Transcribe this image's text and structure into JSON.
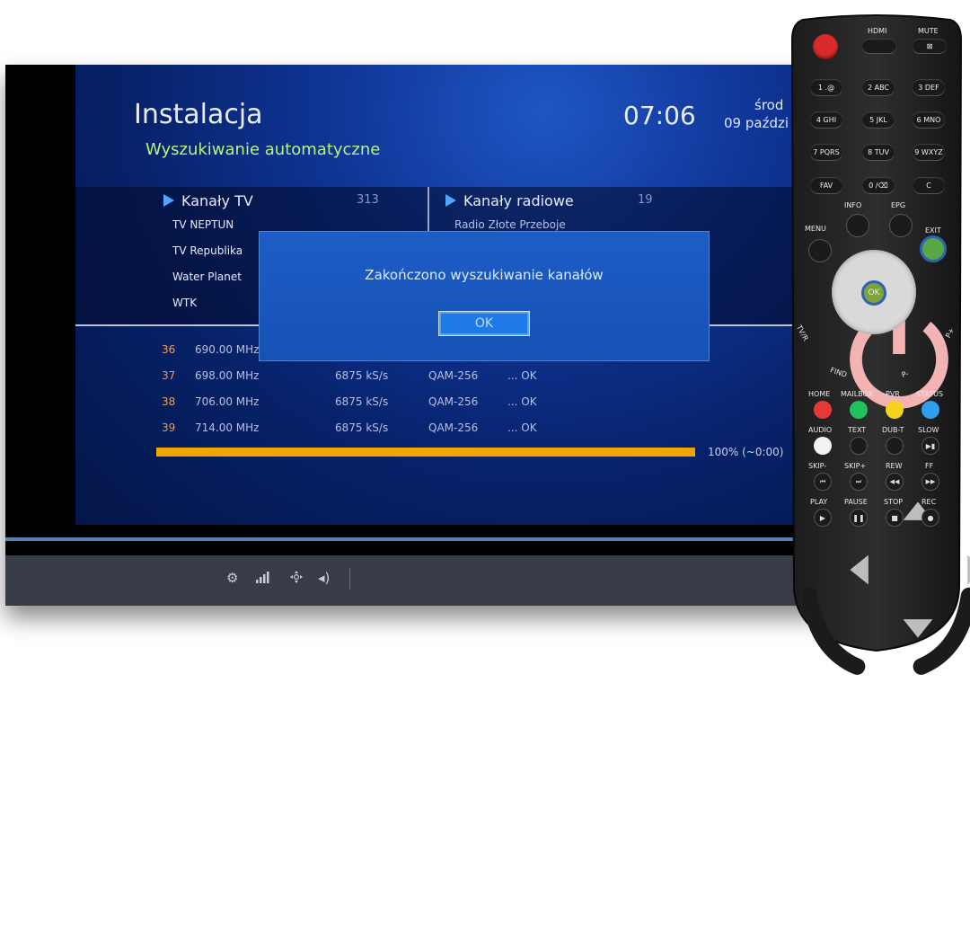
{
  "screen": {
    "title": "Instalacja",
    "subtitle": "Wyszukiwanie automatyczne",
    "clock": "07:06",
    "date_line1": "środ",
    "date_line2": "09 paździ",
    "tv_header": "Kanały TV",
    "tv_count": "313",
    "radio_header": "Kanały radiowe",
    "radio_count": "19",
    "tv_channels": [
      "TV NEPTUN",
      "TV Republika",
      "Water Planet",
      "WTK"
    ],
    "radio_channels": [
      "Radio Złote Przeboje"
    ],
    "scan_rows": [
      {
        "num": "36",
        "freq": "690.00 MHz",
        "rate": "",
        "mod": "",
        "status": ""
      },
      {
        "num": "37",
        "freq": "698.00 MHz",
        "rate": "6875 kS/s",
        "mod": "QAM-256",
        "status": "... OK"
      },
      {
        "num": "38",
        "freq": "706.00 MHz",
        "rate": "6875 kS/s",
        "mod": "QAM-256",
        "status": "... OK"
      },
      {
        "num": "39",
        "freq": "714.00 MHz",
        "rate": "6875 kS/s",
        "mod": "QAM-256",
        "status": "... OK"
      }
    ],
    "progress_fraction": 1.0,
    "progress_text": "100% (~0:00)",
    "dialog_message": "Zakończono wyszukiwanie kanałów",
    "dialog_ok": "OK"
  },
  "bottom_bar_icons": [
    "settings-icon",
    "signal-icon",
    "navigate-icon",
    "volume-icon"
  ],
  "remote": {
    "hdmi": "HDMI",
    "mute": "MUTE",
    "num_keys": [
      "1 .@",
      "2 ABC",
      "3 DEF",
      "4 GHI",
      "5 JKL",
      "6 MNO",
      "7 PQRS",
      "8 TUV",
      "9 WXYZ",
      "FAV",
      "0 /⌫",
      "C"
    ],
    "info": "INFO",
    "epg": "EPG",
    "menu": "MENU",
    "exit": "EXIT",
    "ok": "OK",
    "tv_radio": "TV/R",
    "p_plus": "P+",
    "find": "FIND",
    "p_minus": "P-",
    "color_labels": [
      "HOME",
      "MAILBOX",
      "PVR",
      "STATUS"
    ],
    "row2_labels": [
      "AUDIO",
      "TEXT",
      "DUB-T",
      "SLOW"
    ],
    "row3_labels": [
      "SKIP-",
      "SKIP+",
      "REW",
      "FF"
    ],
    "row4_labels": [
      "PLAY",
      "PAUSE",
      "STOP",
      "REC"
    ],
    "colors": {
      "red": "#e53935",
      "green": "#21c25b",
      "yellow": "#f5d21c",
      "blue": "#2fa0f0",
      "exit_highlight": "#57a844",
      "ok_highlight": "#7fa23a"
    }
  }
}
